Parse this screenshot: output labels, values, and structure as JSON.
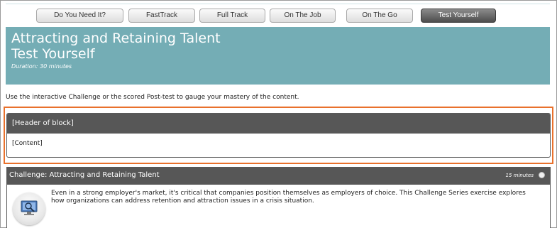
{
  "tabs": [
    {
      "label": "Do You Need It?"
    },
    {
      "label": "FastTrack"
    },
    {
      "label": "Full Track"
    },
    {
      "label": "On The Job"
    },
    {
      "label": "On The Go"
    },
    {
      "label": "Test Yourself",
      "active": true
    }
  ],
  "banner": {
    "title_line1": "Attracting and Retaining Talent",
    "title_line2": "Test Yourself",
    "duration": "Duration: 30 minutes"
  },
  "intro_text": "Use the interactive Challenge or the scored Post-test to gauge your mastery of the content.",
  "block": {
    "header": "[Header of block]",
    "content": "[Content]"
  },
  "challenge": {
    "title": "Challenge: Attracting and Retaining Talent",
    "time": "15 minutes",
    "description": "Even in a strong employer's market, it's critical that companies position themselves as employers of choice. This Challenge Series exercise explores how organizations can address retention and attraction issues in a crisis situation.",
    "icon": "magnifier-monitor-icon"
  },
  "colors": {
    "banner": "#74adb5",
    "header_bar": "#575757",
    "highlight": "#e9712c"
  }
}
